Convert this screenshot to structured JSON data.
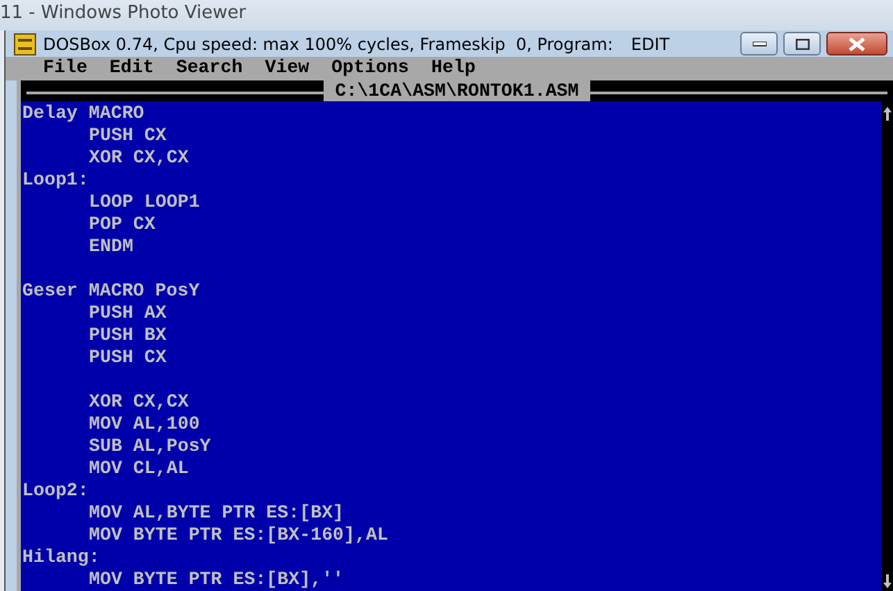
{
  "viewer": {
    "title": "11 - Windows Photo Viewer"
  },
  "window": {
    "title": "DOSBox 0.74, Cpu speed: max 100% cycles, Frameskip  0, Program:",
    "program": "EDIT"
  },
  "menu": [
    "File",
    "Edit",
    "Search",
    "View",
    "Options",
    "Help"
  ],
  "editor": {
    "filename": "C:\\1CA\\ASM\\RONTOK1.ASM",
    "blocks": [
      [
        {
          "text": "Delay MACRO",
          "children": [
            {
              "text": "PUSH CX"
            },
            {
              "text": "XOR CX,CX"
            }
          ]
        },
        {
          "text": "Loop1:",
          "children": [
            {
              "text": "LOOP LOOP1"
            },
            {
              "text": "POP CX"
            },
            {
              "text": "ENDM"
            }
          ]
        }
      ],
      [
        {
          "text": "Geser MACRO PosY",
          "children": [
            {
              "text": "PUSH AX"
            },
            {
              "text": "PUSH BX"
            },
            {
              "text": "PUSH CX"
            }
          ]
        }
      ],
      [
        {
          "children": [
            {
              "text": "XOR CX,CX"
            },
            {
              "text": "MOV AL,100"
            },
            {
              "text": "SUB AL,PosY"
            },
            {
              "text": "MOV CL,AL"
            }
          ]
        },
        {
          "text": "Loop2:",
          "children": [
            {
              "text": "MOV AL,BYTE PTR ES:[BX]"
            },
            {
              "text": "MOV BYTE PTR ES:[BX-160],AL"
            }
          ]
        },
        {
          "text": "Hilang:",
          "children": [
            {
              "text": "MOV BYTE PTR ES:[BX],''"
            }
          ]
        }
      ]
    ]
  }
}
